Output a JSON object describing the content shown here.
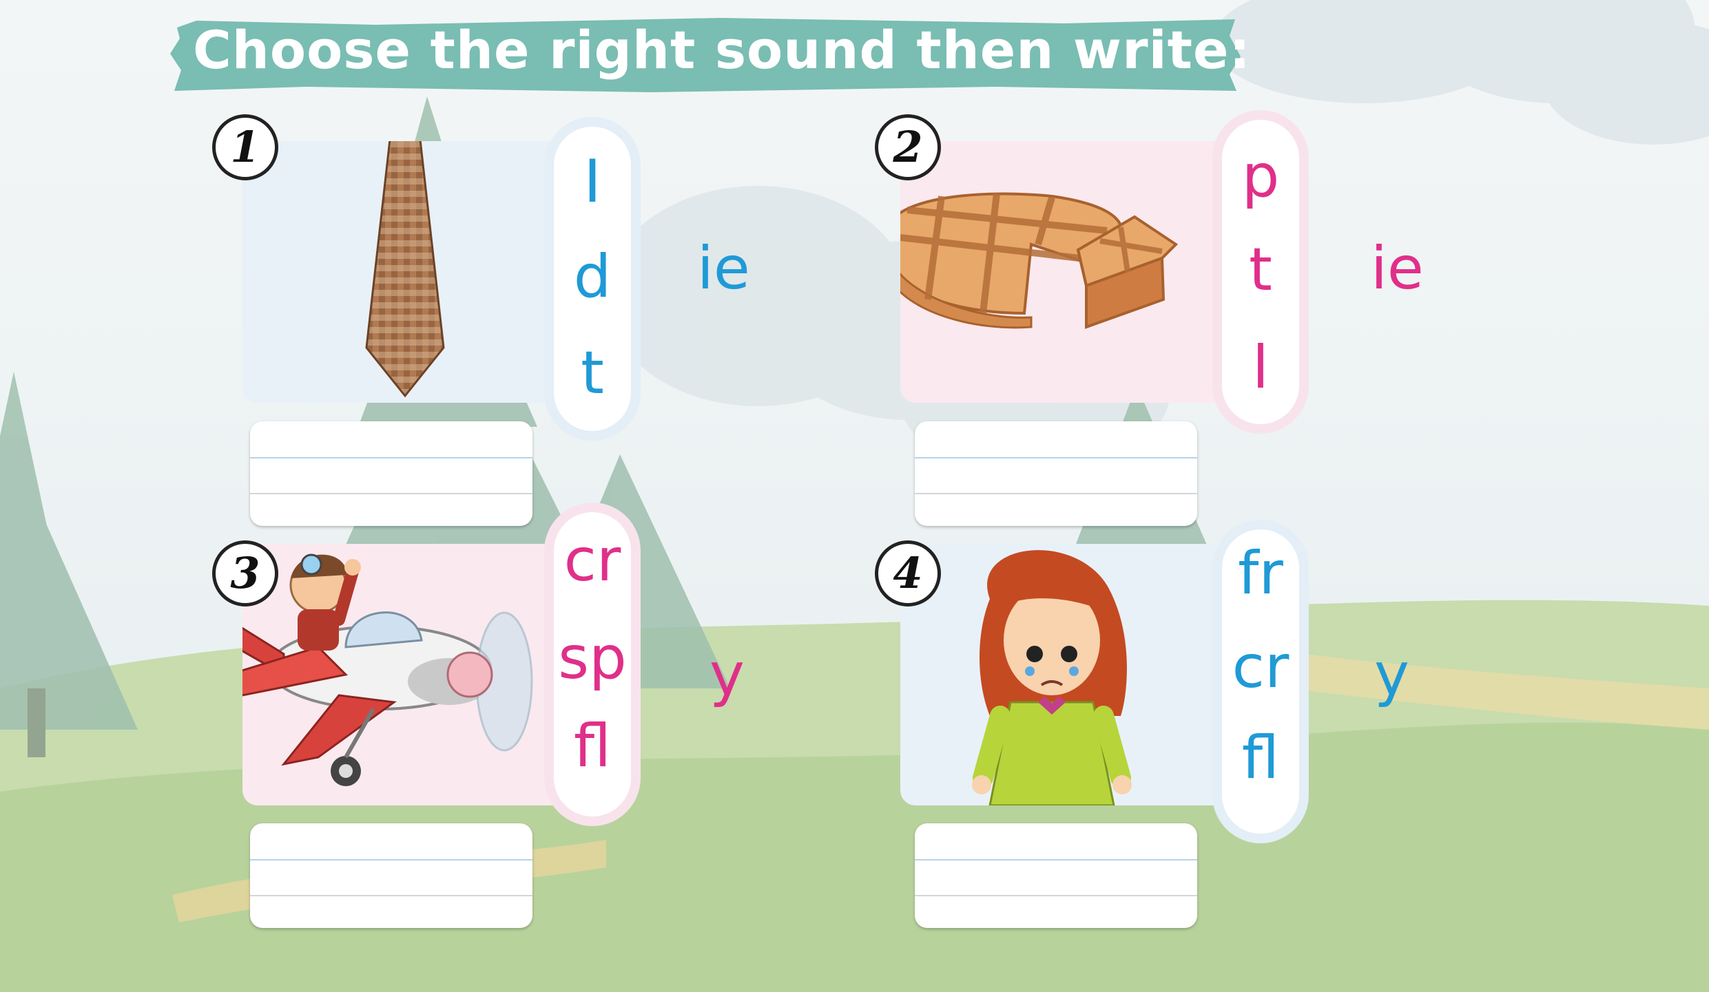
{
  "title": "Choose the right sound then write:",
  "colors": {
    "blue": "#1f9ad6",
    "pink": "#e02f8a",
    "banner": "#79bdb3"
  },
  "exercises": [
    {
      "number": "1",
      "picture": "tie",
      "options": [
        "I",
        "d",
        "t"
      ],
      "suffix": "ie",
      "color": "blue"
    },
    {
      "number": "2",
      "picture": "pie",
      "options": [
        "p",
        "t",
        "l"
      ],
      "suffix": "ie",
      "color": "pink"
    },
    {
      "number": "3",
      "picture": "boy-flying-airplane",
      "options": [
        "cr",
        "sp",
        "fl"
      ],
      "suffix": "y",
      "color": "pink"
    },
    {
      "number": "4",
      "picture": "crying-girl",
      "options": [
        "fr",
        "cr",
        "fl"
      ],
      "suffix": "y",
      "color": "blue"
    }
  ]
}
